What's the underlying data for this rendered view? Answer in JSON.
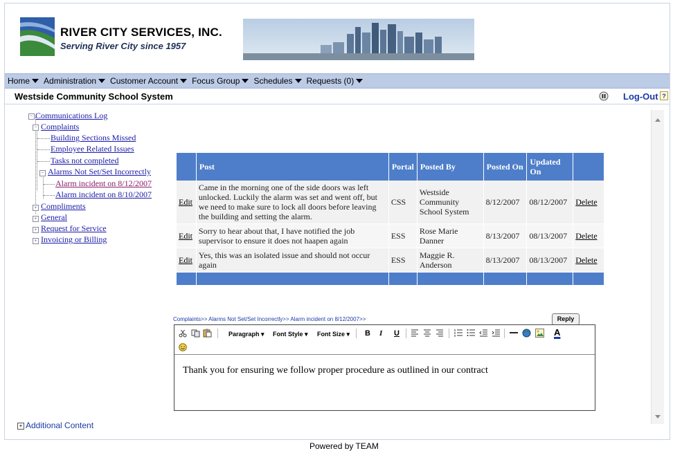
{
  "header": {
    "company_name": "RIVER CITY SERVICES, INC.",
    "tagline": "Serving River City since 1957"
  },
  "menu": [
    {
      "label": "Home"
    },
    {
      "label": "Administration"
    },
    {
      "label": "Customer Account"
    },
    {
      "label": "Focus Group"
    },
    {
      "label": "Schedules"
    },
    {
      "label": "Requests (0)"
    }
  ],
  "titlebar": {
    "org_title": "Westside Community School System",
    "logout": "Log-Out"
  },
  "tree": {
    "root": "Communications Log",
    "complaints": "Complaints",
    "building": "Building Sections Missed",
    "employee": "Employee Related Issues",
    "tasks": "Tasks not completed",
    "alarms": "Alarms Not Set/Set Incorrectly",
    "alarm1": "Alarm incident on 8/12/2007",
    "alarm2": "Alarm incident on 8/10/2007",
    "compliments": "Compliments",
    "general": "General",
    "request": "Request for Service",
    "invoicing": "Invoicing or Billing"
  },
  "table": {
    "headers": {
      "post": "Post",
      "portal": "Portal",
      "posted_by": "Posted By",
      "posted_on": "Posted On",
      "updated_on": "Updated On"
    },
    "edit_label": "Edit",
    "delete_label": "Delete",
    "rows": [
      {
        "post": "Came in the morning one of the side doors was left unlocked. Luckily the alarm was set and went off, but we need to make sure to lock all doors before leaving the building and setting the alarm.",
        "portal": "CSS",
        "posted_by": "Westside Community School System",
        "posted_on": "8/12/2007",
        "updated_on": "08/12/2007"
      },
      {
        "post": "Sorry to hear about that, I have notified the job supervisor to ensure it does not haapen again",
        "portal": "ESS",
        "posted_by": "Rose Marie Danner",
        "posted_on": "8/13/2007",
        "updated_on": "08/13/2007"
      },
      {
        "post": "Yes, this was an isolated issue and should not occur again",
        "portal": "ESS",
        "posted_by": "Maggie R. Anderson",
        "posted_on": "8/13/2007",
        "updated_on": "08/13/2007"
      }
    ]
  },
  "breadcrumb": "Complaints>> Alarms Not Set/Set Incorrectly>> Alarm incident on 8/12/2007>>",
  "reply_label": "Reply",
  "toolbar": {
    "paragraph": "Paragraph",
    "font_style": "Font Style",
    "font_size": "Font Size",
    "bold": "B",
    "italic": "I",
    "underline": "U",
    "font_color": "A"
  },
  "editor_text": "Thank you for ensuring we follow proper procedure as outlined in our contract",
  "additional_content": "Additional Content",
  "powered_by": "Powered by TEAM"
}
